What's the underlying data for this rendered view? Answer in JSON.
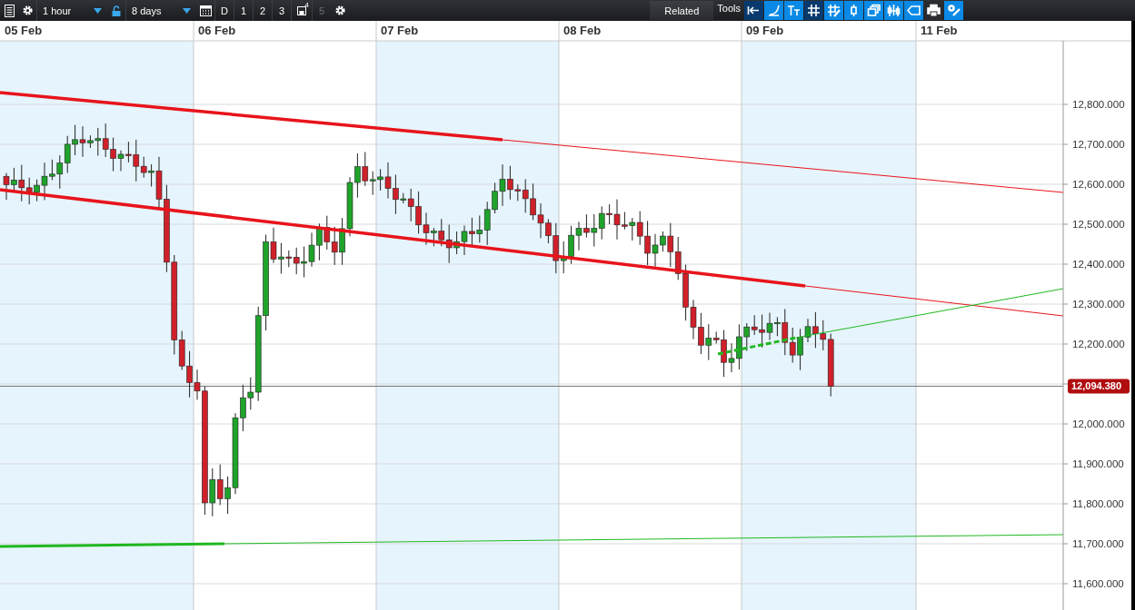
{
  "toolbar": {
    "interval": "1 hour",
    "range": "8 days",
    "view_buttons": [
      {
        "label": "D",
        "disabled": false
      },
      {
        "label": "1",
        "disabled": false
      },
      {
        "label": "2",
        "disabled": false
      },
      {
        "label": "3",
        "disabled": false
      }
    ],
    "save_slot": "4",
    "slot_5": {
      "label": "5",
      "disabled": true
    },
    "related": "Related",
    "tools_label": "Tools",
    "tools": [
      {
        "kind": "back",
        "selected": true
      },
      {
        "kind": "curve",
        "selected": false
      },
      {
        "kind": "text",
        "selected": false
      },
      {
        "kind": "grid",
        "selected": true
      },
      {
        "kind": "draw",
        "selected": false
      },
      {
        "kind": "candle",
        "selected": false
      },
      {
        "kind": "windows",
        "selected": false
      },
      {
        "kind": "candles",
        "selected": false
      },
      {
        "kind": "tag",
        "selected": false
      },
      {
        "kind": "print",
        "selected": false
      },
      {
        "kind": "settings",
        "selected": false
      }
    ]
  },
  "chart": {
    "dates": [
      {
        "label": "05 Feb",
        "shaded": true
      },
      {
        "label": "06 Feb",
        "shaded": false
      },
      {
        "label": "07 Feb",
        "shaded": true
      },
      {
        "label": "08 Feb",
        "shaded": false
      },
      {
        "label": "09 Feb",
        "shaded": true
      },
      {
        "label": "11 Feb",
        "shaded": false
      }
    ],
    "y_ticks": [
      "12,800.000",
      "12,700.000",
      "12,600.000",
      "12,500.000",
      "12,400.000",
      "12,300.000",
      "12,200.000",
      "12,000.000",
      "11,900.000",
      "11,800.000",
      "11,700.000",
      "11,600.000"
    ],
    "price_label": "12,094.380"
  }
}
